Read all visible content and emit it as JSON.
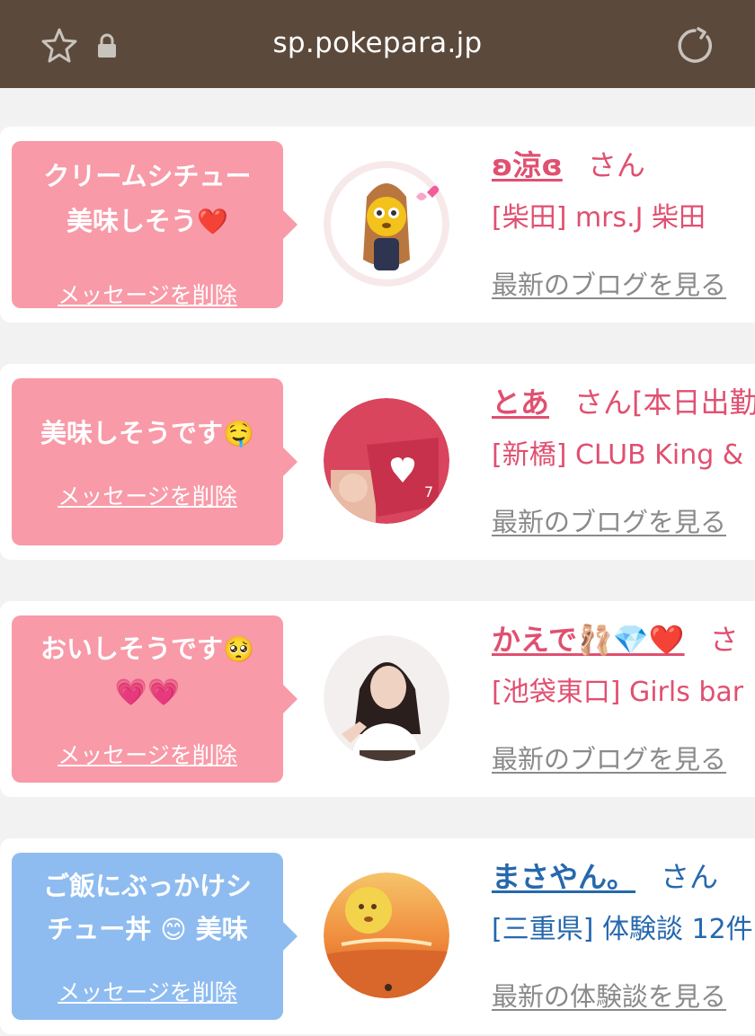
{
  "browser": {
    "url": "sp.pokepara.jp",
    "icons": [
      "star-icon",
      "lock-icon",
      "reload-icon"
    ]
  },
  "colors": {
    "toolbar": "#5b4a3b",
    "pink_bubble": "#f89aa8",
    "blue_bubble": "#8ebcf0",
    "pink_text": "#e05070",
    "blue_text": "#2668ad",
    "link_gray": "#8a8a8a"
  },
  "items": [
    {
      "message_line1": "クリームシチュー",
      "message_line2": "美味しそう",
      "message_emoji": "❤️",
      "delete_label": "メッセージを削除",
      "name": "ʚ涼ɞ",
      "honorific": "さん",
      "shop": "[柴田] mrs.J 柴田",
      "blog_link": "最新のブログを見る"
    },
    {
      "message_line1": "美味しそうです",
      "message_emoji": "🤤",
      "delete_label": "メッセージを削除",
      "name": "とあ",
      "honorific": "さん[本日出勤",
      "shop": "[新橋] CLUB King &",
      "blog_link": "最新のブログを見る"
    },
    {
      "message_line1": "おいしそうです",
      "message_emoji": "🥺",
      "message_line2_emoji": "💗💗",
      "delete_label": "メッセージを削除",
      "name": "かえで",
      "name_emoji": "🩰💎❤️",
      "honorific": "さ",
      "shop": "[池袋東口] Girls bar",
      "blog_link": "最新のブログを見る"
    },
    {
      "message_line1": "ご飯にぶっかけシ",
      "message_line2": "チュー丼",
      "message_line2_emoji": "😊",
      "message_line2_tail": "美味",
      "delete_label": "メッセージを削除",
      "name": "まさやん。",
      "honorific": "さん",
      "shop": "[三重県] 体験談 12件",
      "blog_link": "最新の体験談を見る"
    }
  ]
}
